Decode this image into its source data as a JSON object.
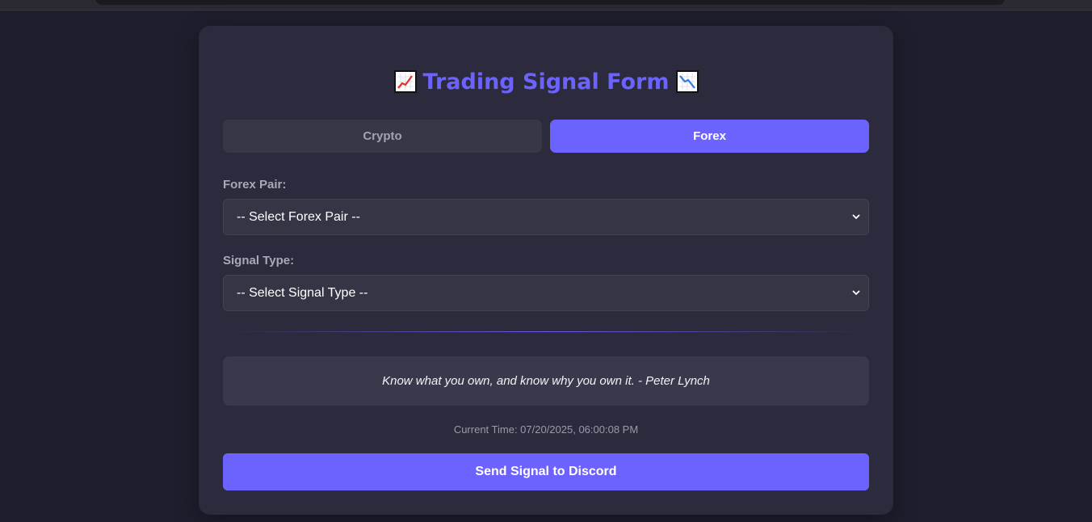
{
  "header": {
    "title": "Trading Signal Form",
    "left_icon": "chart-increasing-icon",
    "right_icon": "chart-decreasing-icon"
  },
  "tabs": [
    {
      "label": "Crypto",
      "active": false
    },
    {
      "label": "Forex",
      "active": true
    }
  ],
  "form": {
    "pair_label": "Forex Pair:",
    "pair_value": "-- Select Forex Pair --",
    "signal_label": "Signal Type:",
    "signal_value": "-- Select Signal Type --"
  },
  "quote": "Know what you own, and know why you own it. - Peter Lynch",
  "current_time": "Current Time: 07/20/2025, 06:00:08 PM",
  "send_button": "Send Signal to Discord",
  "colors": {
    "accent": "#6c63ff",
    "background": "#1f1e2e",
    "card": "#2c2b3d"
  }
}
